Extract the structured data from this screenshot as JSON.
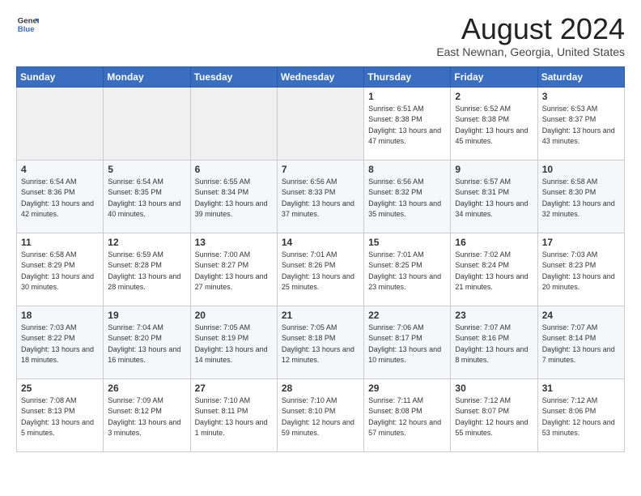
{
  "header": {
    "logo_general": "General",
    "logo_blue": "Blue",
    "month_title": "August 2024",
    "location": "East Newnan, Georgia, United States"
  },
  "weekdays": [
    "Sunday",
    "Monday",
    "Tuesday",
    "Wednesday",
    "Thursday",
    "Friday",
    "Saturday"
  ],
  "weeks": [
    [
      {
        "day": "",
        "sunrise": "",
        "sunset": "",
        "daylight": "",
        "empty": true
      },
      {
        "day": "",
        "sunrise": "",
        "sunset": "",
        "daylight": "",
        "empty": true
      },
      {
        "day": "",
        "sunrise": "",
        "sunset": "",
        "daylight": "",
        "empty": true
      },
      {
        "day": "",
        "sunrise": "",
        "sunset": "",
        "daylight": "",
        "empty": true
      },
      {
        "day": "1",
        "sunrise": "Sunrise: 6:51 AM",
        "sunset": "Sunset: 8:38 PM",
        "daylight": "Daylight: 13 hours and 47 minutes.",
        "empty": false
      },
      {
        "day": "2",
        "sunrise": "Sunrise: 6:52 AM",
        "sunset": "Sunset: 8:38 PM",
        "daylight": "Daylight: 13 hours and 45 minutes.",
        "empty": false
      },
      {
        "day": "3",
        "sunrise": "Sunrise: 6:53 AM",
        "sunset": "Sunset: 8:37 PM",
        "daylight": "Daylight: 13 hours and 43 minutes.",
        "empty": false
      }
    ],
    [
      {
        "day": "4",
        "sunrise": "Sunrise: 6:54 AM",
        "sunset": "Sunset: 8:36 PM",
        "daylight": "Daylight: 13 hours and 42 minutes.",
        "empty": false
      },
      {
        "day": "5",
        "sunrise": "Sunrise: 6:54 AM",
        "sunset": "Sunset: 8:35 PM",
        "daylight": "Daylight: 13 hours and 40 minutes.",
        "empty": false
      },
      {
        "day": "6",
        "sunrise": "Sunrise: 6:55 AM",
        "sunset": "Sunset: 8:34 PM",
        "daylight": "Daylight: 13 hours and 39 minutes.",
        "empty": false
      },
      {
        "day": "7",
        "sunrise": "Sunrise: 6:56 AM",
        "sunset": "Sunset: 8:33 PM",
        "daylight": "Daylight: 13 hours and 37 minutes.",
        "empty": false
      },
      {
        "day": "8",
        "sunrise": "Sunrise: 6:56 AM",
        "sunset": "Sunset: 8:32 PM",
        "daylight": "Daylight: 13 hours and 35 minutes.",
        "empty": false
      },
      {
        "day": "9",
        "sunrise": "Sunrise: 6:57 AM",
        "sunset": "Sunset: 8:31 PM",
        "daylight": "Daylight: 13 hours and 34 minutes.",
        "empty": false
      },
      {
        "day": "10",
        "sunrise": "Sunrise: 6:58 AM",
        "sunset": "Sunset: 8:30 PM",
        "daylight": "Daylight: 13 hours and 32 minutes.",
        "empty": false
      }
    ],
    [
      {
        "day": "11",
        "sunrise": "Sunrise: 6:58 AM",
        "sunset": "Sunset: 8:29 PM",
        "daylight": "Daylight: 13 hours and 30 minutes.",
        "empty": false
      },
      {
        "day": "12",
        "sunrise": "Sunrise: 6:59 AM",
        "sunset": "Sunset: 8:28 PM",
        "daylight": "Daylight: 13 hours and 28 minutes.",
        "empty": false
      },
      {
        "day": "13",
        "sunrise": "Sunrise: 7:00 AM",
        "sunset": "Sunset: 8:27 PM",
        "daylight": "Daylight: 13 hours and 27 minutes.",
        "empty": false
      },
      {
        "day": "14",
        "sunrise": "Sunrise: 7:01 AM",
        "sunset": "Sunset: 8:26 PM",
        "daylight": "Daylight: 13 hours and 25 minutes.",
        "empty": false
      },
      {
        "day": "15",
        "sunrise": "Sunrise: 7:01 AM",
        "sunset": "Sunset: 8:25 PM",
        "daylight": "Daylight: 13 hours and 23 minutes.",
        "empty": false
      },
      {
        "day": "16",
        "sunrise": "Sunrise: 7:02 AM",
        "sunset": "Sunset: 8:24 PM",
        "daylight": "Daylight: 13 hours and 21 minutes.",
        "empty": false
      },
      {
        "day": "17",
        "sunrise": "Sunrise: 7:03 AM",
        "sunset": "Sunset: 8:23 PM",
        "daylight": "Daylight: 13 hours and 20 minutes.",
        "empty": false
      }
    ],
    [
      {
        "day": "18",
        "sunrise": "Sunrise: 7:03 AM",
        "sunset": "Sunset: 8:22 PM",
        "daylight": "Daylight: 13 hours and 18 minutes.",
        "empty": false
      },
      {
        "day": "19",
        "sunrise": "Sunrise: 7:04 AM",
        "sunset": "Sunset: 8:20 PM",
        "daylight": "Daylight: 13 hours and 16 minutes.",
        "empty": false
      },
      {
        "day": "20",
        "sunrise": "Sunrise: 7:05 AM",
        "sunset": "Sunset: 8:19 PM",
        "daylight": "Daylight: 13 hours and 14 minutes.",
        "empty": false
      },
      {
        "day": "21",
        "sunrise": "Sunrise: 7:05 AM",
        "sunset": "Sunset: 8:18 PM",
        "daylight": "Daylight: 13 hours and 12 minutes.",
        "empty": false
      },
      {
        "day": "22",
        "sunrise": "Sunrise: 7:06 AM",
        "sunset": "Sunset: 8:17 PM",
        "daylight": "Daylight: 13 hours and 10 minutes.",
        "empty": false
      },
      {
        "day": "23",
        "sunrise": "Sunrise: 7:07 AM",
        "sunset": "Sunset: 8:16 PM",
        "daylight": "Daylight: 13 hours and 8 minutes.",
        "empty": false
      },
      {
        "day": "24",
        "sunrise": "Sunrise: 7:07 AM",
        "sunset": "Sunset: 8:14 PM",
        "daylight": "Daylight: 13 hours and 7 minutes.",
        "empty": false
      }
    ],
    [
      {
        "day": "25",
        "sunrise": "Sunrise: 7:08 AM",
        "sunset": "Sunset: 8:13 PM",
        "daylight": "Daylight: 13 hours and 5 minutes.",
        "empty": false
      },
      {
        "day": "26",
        "sunrise": "Sunrise: 7:09 AM",
        "sunset": "Sunset: 8:12 PM",
        "daylight": "Daylight: 13 hours and 3 minutes.",
        "empty": false
      },
      {
        "day": "27",
        "sunrise": "Sunrise: 7:10 AM",
        "sunset": "Sunset: 8:11 PM",
        "daylight": "Daylight: 13 hours and 1 minute.",
        "empty": false
      },
      {
        "day": "28",
        "sunrise": "Sunrise: 7:10 AM",
        "sunset": "Sunset: 8:10 PM",
        "daylight": "Daylight: 12 hours and 59 minutes.",
        "empty": false
      },
      {
        "day": "29",
        "sunrise": "Sunrise: 7:11 AM",
        "sunset": "Sunset: 8:08 PM",
        "daylight": "Daylight: 12 hours and 57 minutes.",
        "empty": false
      },
      {
        "day": "30",
        "sunrise": "Sunrise: 7:12 AM",
        "sunset": "Sunset: 8:07 PM",
        "daylight": "Daylight: 12 hours and 55 minutes.",
        "empty": false
      },
      {
        "day": "31",
        "sunrise": "Sunrise: 7:12 AM",
        "sunset": "Sunset: 8:06 PM",
        "daylight": "Daylight: 12 hours and 53 minutes.",
        "empty": false
      }
    ]
  ]
}
